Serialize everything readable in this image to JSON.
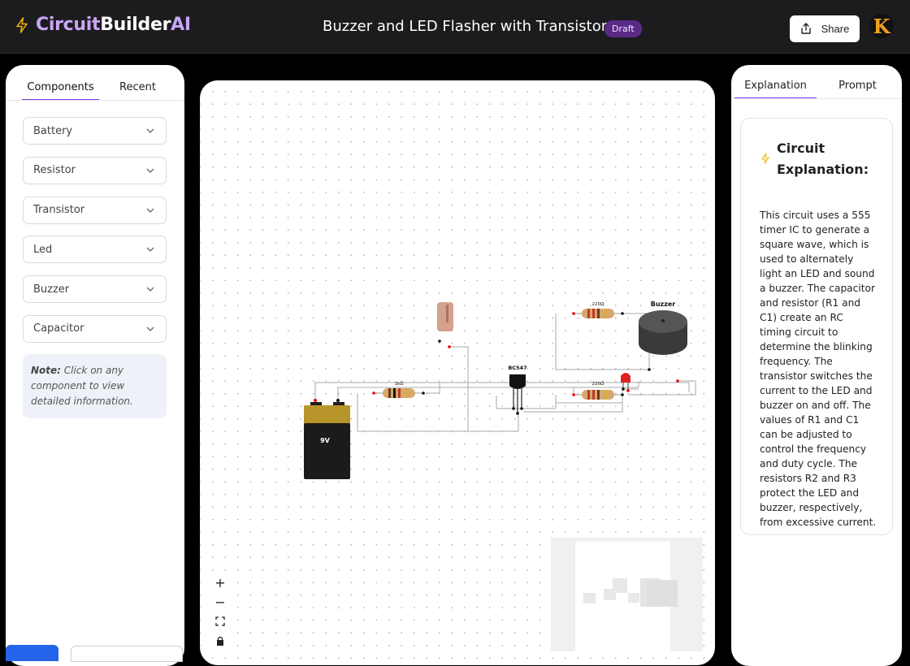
{
  "header": {
    "brand_part1": "Circuit",
    "brand_part2": "Builder",
    "brand_part3": "AI",
    "title": "Buzzer and LED Flasher with Transistor",
    "badge": "Draft",
    "share_label": "Share",
    "avatar_letter": "K"
  },
  "left_panel": {
    "tabs": [
      "Components",
      "Recent"
    ],
    "components": [
      "Battery",
      "Resistor",
      "Transistor",
      "Led",
      "Buzzer",
      "Capacitor"
    ],
    "note_label": "Note:",
    "note_text": "Click on any component to view detailed information."
  },
  "canvas": {
    "battery_label": "9V",
    "transistor_label": "BC547",
    "buzzer_label": "Buzzer",
    "resistor_1k_label": "1kΩ",
    "resistor_220_top_label": "220Ω",
    "resistor_220_bottom_label": "220Ω",
    "zoom_in": "+",
    "zoom_out": "−"
  },
  "right_panel": {
    "tabs": [
      "Explanation",
      "Prompt"
    ],
    "heading": "Circuit Explanation:",
    "body": "This circuit uses a 555 timer IC to generate a square wave, which is used to alternately light an LED and sound a buzzer. The capacitor and resistor (R1 and C1) create an RC timing circuit to determine the blinking frequency. The transistor switches the current to the LED and buzzer on and off. The values of R1 and C1 can be adjusted to control the frequency and duty cycle. The resistors R2 and R3 protect the LED and buzzer, respectively, from excessive current."
  },
  "colors": {
    "accent": "#7c3aed",
    "brand_accent": "#c9a6f5",
    "badge_bg": "#5b2a86",
    "bolt": "#f5b800"
  }
}
